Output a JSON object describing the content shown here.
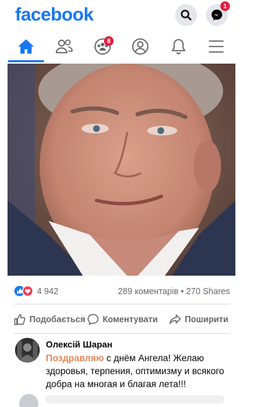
{
  "app": {
    "logo": "facebook",
    "brand_color": "#1877f2",
    "messenger_badge": "1"
  },
  "nav": {
    "items": [
      {
        "name": "home",
        "icon": "home-icon",
        "active": true
      },
      {
        "name": "friends",
        "icon": "friends-icon"
      },
      {
        "name": "groups",
        "icon": "groups-icon",
        "badge": "8"
      },
      {
        "name": "profile",
        "icon": "profile-icon"
      },
      {
        "name": "notifications",
        "icon": "bell-icon"
      },
      {
        "name": "menu",
        "icon": "hamburger-menu-icon"
      }
    ]
  },
  "post": {
    "reactions_count": "4 942",
    "reaction_icons": [
      "like-icon",
      "love-icon"
    ],
    "comments_shares": "289 коментарів • 270 Shares",
    "actions": {
      "like": "Подобається",
      "comment": "Коментувати",
      "share": "Поширити"
    }
  },
  "comment": {
    "author": "Олексій Шаран",
    "highlight": "Поздравляю",
    "text": " с днём Ангела! Желаю здоровья, терпения, оптимизму и всякого добра на многая и благая лета!!!"
  },
  "colors": {
    "like_blue": "#1877f2",
    "love_red": "#f33e58",
    "badge_red": "#e41e3f",
    "comment_highlight": "#e4875a"
  }
}
